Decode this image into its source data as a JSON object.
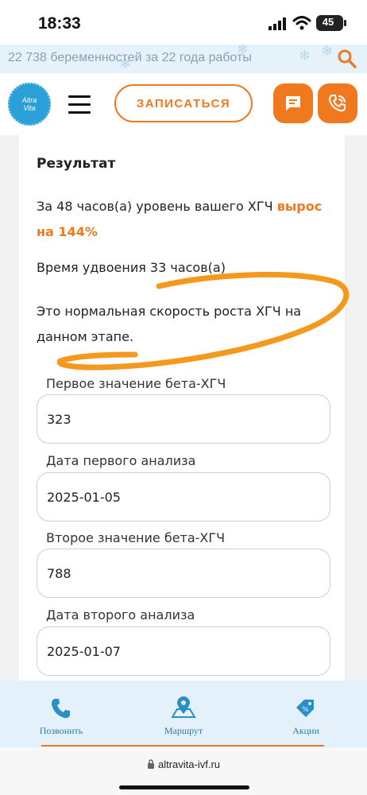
{
  "status_bar": {
    "time": "18:33",
    "battery": "45"
  },
  "banner": {
    "text": "22 738 беременностей за 22 года работы"
  },
  "header": {
    "logo_line1": "Altra",
    "logo_line2": "Vita",
    "cta_label": "ЗАПИСАТЬСЯ"
  },
  "result": {
    "heading": "Результат",
    "growth_prefix": "За 48 часов(а) уровень вашего ХГЧ ",
    "growth_highlight": "вырос на 144%",
    "doubling": "Время удвоения 33 часов(а)",
    "verdict": "Это нормальная скорость роста ХГЧ на данном этапе."
  },
  "form": {
    "fields": [
      {
        "label": "Первое значение бета-ХГЧ",
        "value": "323"
      },
      {
        "label": "Дата первого анализа",
        "value": "2025-01-05"
      },
      {
        "label": "Второе значение бета-ХГЧ",
        "value": "788"
      },
      {
        "label": "Дата второго анализа",
        "value": "2025-01-07"
      }
    ]
  },
  "bottom_nav": {
    "call": "Позвонить",
    "route": "Маршрут",
    "promo": "Акции"
  },
  "browser": {
    "url": "altravita-ivf.ru"
  },
  "colors": {
    "accent": "#f07920",
    "brand_blue": "#2a9fd8",
    "nav_text": "#2a7fb0"
  }
}
